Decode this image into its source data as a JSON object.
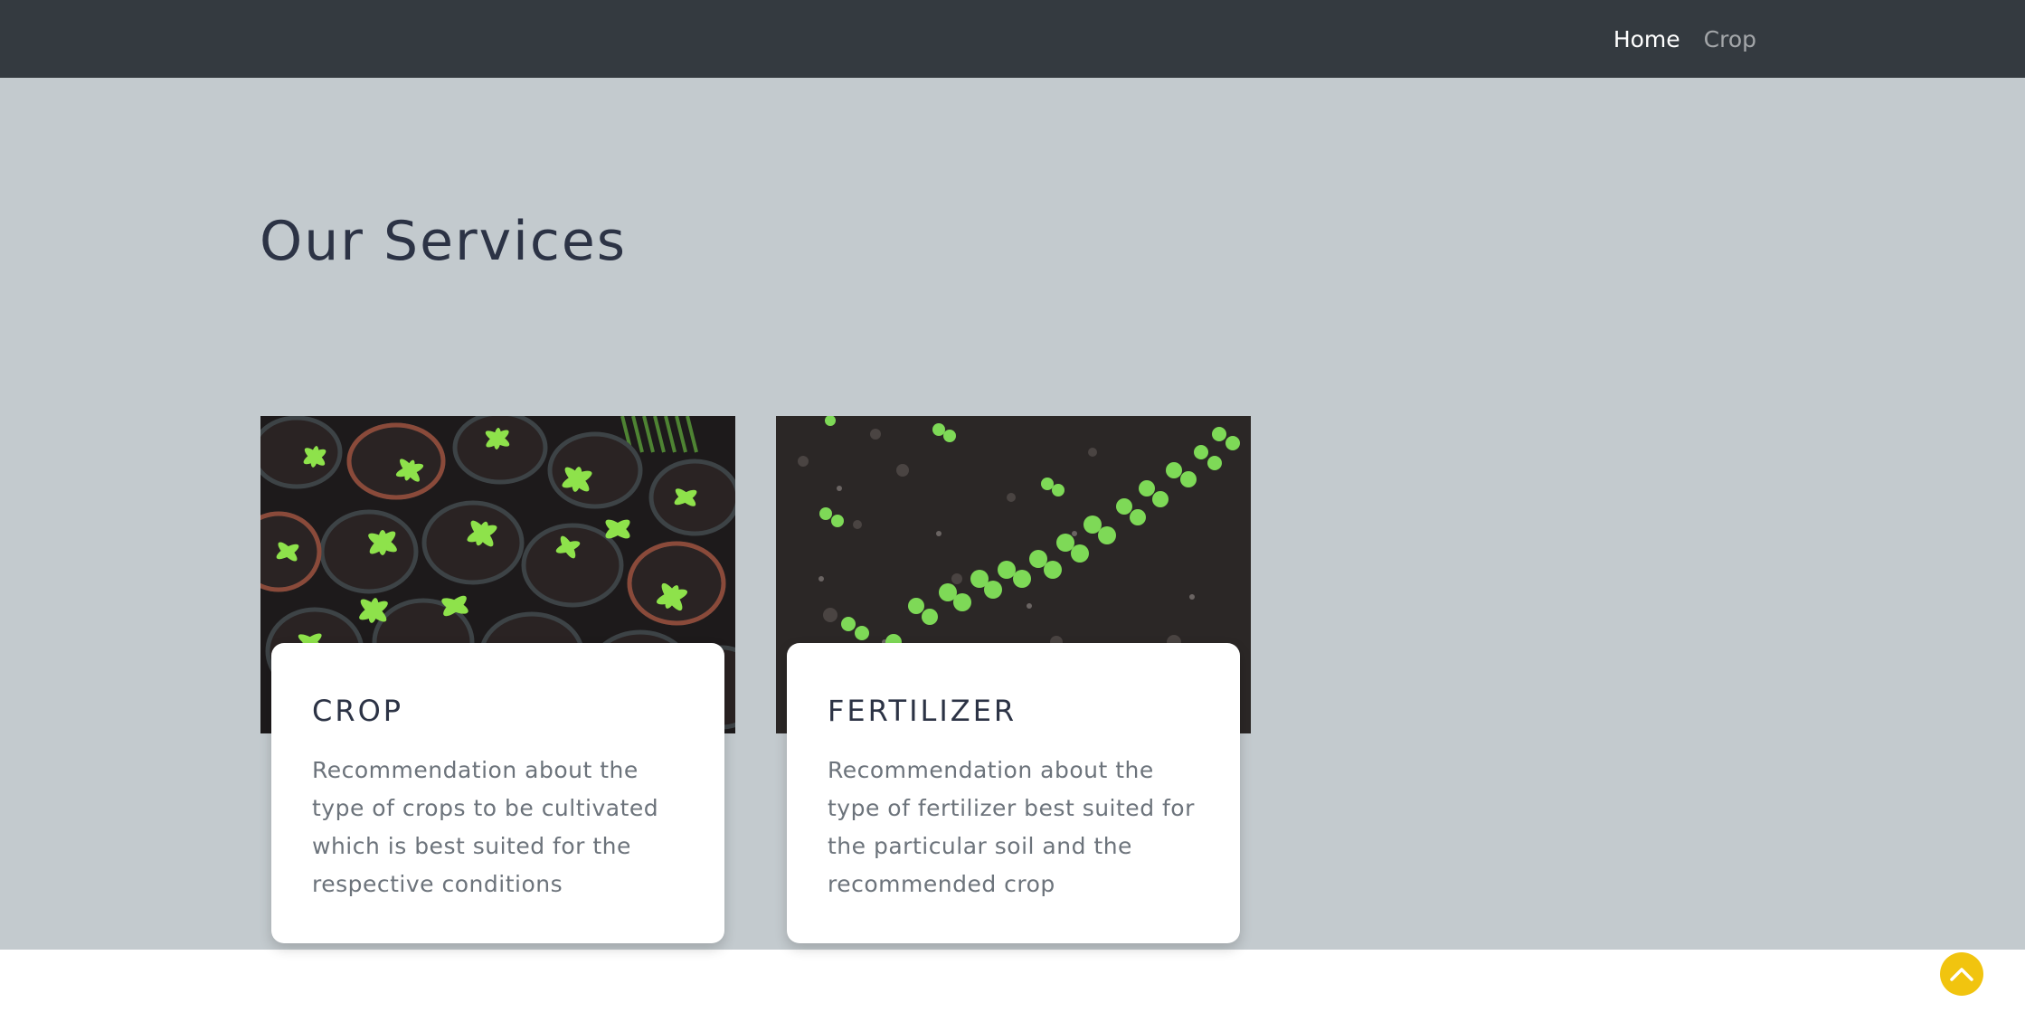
{
  "nav": {
    "items": [
      {
        "label": "Home",
        "state": "active"
      },
      {
        "label": "Crop",
        "state": "inactive"
      }
    ]
  },
  "services": {
    "title": "Our Services",
    "cards": [
      {
        "image_icon": "seedlings-in-pots-photo",
        "title": "CROP",
        "text": "Recommendation about the type of crops to be cultivated which is best suited for the respective conditions"
      },
      {
        "image_icon": "sprouts-in-soil-photo",
        "title": "FERTILIZER",
        "text": "Recommendation about the type of fertilizer best suited for the particular soil and the recommended crop"
      }
    ]
  },
  "scroll_top": {
    "icon": "chevron-up-icon",
    "color": "#f1c40f"
  },
  "colors": {
    "navbar": "#343a40",
    "section_bg": "#c3cace",
    "heading": "#2c3345",
    "body_text": "#6c737b"
  }
}
